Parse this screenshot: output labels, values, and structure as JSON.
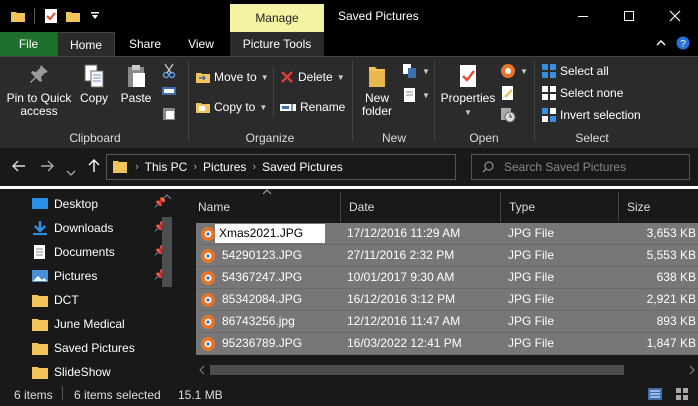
{
  "window": {
    "title": "Saved Pictures",
    "manage_label": "Manage",
    "minimize": "–",
    "maximize": "☐",
    "close": "✕"
  },
  "tabs": {
    "file": "File",
    "home": "Home",
    "share": "Share",
    "view": "View",
    "picture_tools": "Picture Tools"
  },
  "ribbon": {
    "clipboard": {
      "label": "Clipboard",
      "pin": "Pin to Quick access",
      "pin_line1": "Pin to Quick",
      "pin_line2": "access",
      "copy": "Copy",
      "paste": "Paste"
    },
    "organize": {
      "label": "Organize",
      "move_to": "Move to",
      "copy_to": "Copy to",
      "delete": "Delete",
      "rename": "Rename"
    },
    "new": {
      "label": "New",
      "new_folder_line1": "New",
      "new_folder_line2": "folder"
    },
    "open": {
      "label": "Open",
      "properties": "Properties"
    },
    "select": {
      "label": "Select",
      "select_all": "Select all",
      "select_none": "Select none",
      "invert": "Invert selection"
    }
  },
  "address": {
    "crumbs": [
      "This PC",
      "Pictures",
      "Saved Pictures"
    ],
    "search_placeholder": "Search Saved Pictures"
  },
  "nav": {
    "items": [
      {
        "label": "Desktop",
        "pinned": true
      },
      {
        "label": "Downloads",
        "pinned": true
      },
      {
        "label": "Documents",
        "pinned": true
      },
      {
        "label": "Pictures",
        "pinned": true
      },
      {
        "label": "DCT",
        "pinned": false
      },
      {
        "label": "June Medical",
        "pinned": false
      },
      {
        "label": "Saved Pictures",
        "pinned": false
      },
      {
        "label": "SlideShow",
        "pinned": false
      }
    ]
  },
  "columns": {
    "name": "Name",
    "date": "Date",
    "type": "Type",
    "size": "Size"
  },
  "files": [
    {
      "name": "Xmas2021.JPG",
      "date": "17/12/2016 11:29 AM",
      "type": "JPG File",
      "size": "3,653 KB",
      "renaming": true
    },
    {
      "name": "54290123.JPG",
      "date": "27/11/2016 2:32 PM",
      "type": "JPG File",
      "size": "5,553 KB"
    },
    {
      "name": "54367247.JPG",
      "date": "10/01/2017 9:30 AM",
      "type": "JPG File",
      "size": "638 KB"
    },
    {
      "name": "85342084.JPG",
      "date": "16/12/2016 3:12 PM",
      "type": "JPG File",
      "size": "2,921 KB"
    },
    {
      "name": "86743256.jpg",
      "date": "12/12/2016 11:47 AM",
      "type": "JPG File",
      "size": "893 KB"
    },
    {
      "name": "95236789.JPG",
      "date": "16/03/2022 12:41 PM",
      "type": "JPG File",
      "size": "1,847 KB"
    }
  ],
  "status": {
    "count": "6 items",
    "selected": "6 items selected",
    "size": "15.1 MB"
  },
  "colors": {
    "file_tab": "#1e6e2c",
    "manage_tab": "#f4f3a3",
    "selected_row": "#777777",
    "folder": "#f2c55c"
  }
}
